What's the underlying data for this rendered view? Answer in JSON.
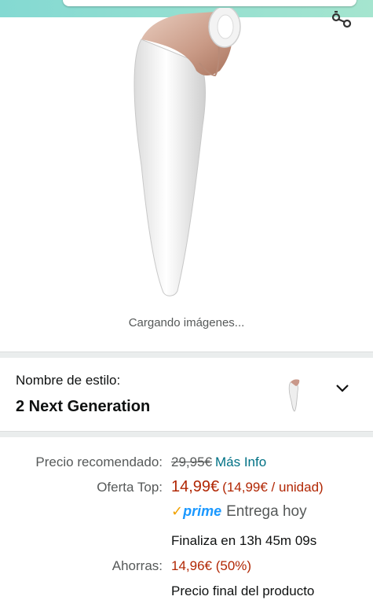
{
  "header": {
    "share_icon": "share-icon"
  },
  "gallery": {
    "loading_text": "Cargando imágenes..."
  },
  "style": {
    "label": "Nombre de estilo:",
    "value": "2 Next Generation",
    "dropdown_icon": "chevron-down-icon"
  },
  "pricing": {
    "recommended_label": "Precio recomendado:",
    "recommended_price": "29,95€",
    "more_info": "Más Info",
    "offer_label": "Oferta Top:",
    "offer_price": "14,99€",
    "unit_price": "(14,99€ / unidad)",
    "prime_check": "✓",
    "prime_word": "prime",
    "delivery": "Entrega hoy",
    "ends_in": "Finaliza en 13h 45m 09s",
    "savings_label": "Ahorras:",
    "savings_value": "14,96€ (50%)",
    "final_price_note": "Precio final del producto"
  },
  "colors": {
    "accent_price": "#b12704",
    "link": "#007185",
    "prime_blue": "#1a98ff",
    "prime_check": "#f0a100",
    "top_band": "#84d9d2"
  }
}
